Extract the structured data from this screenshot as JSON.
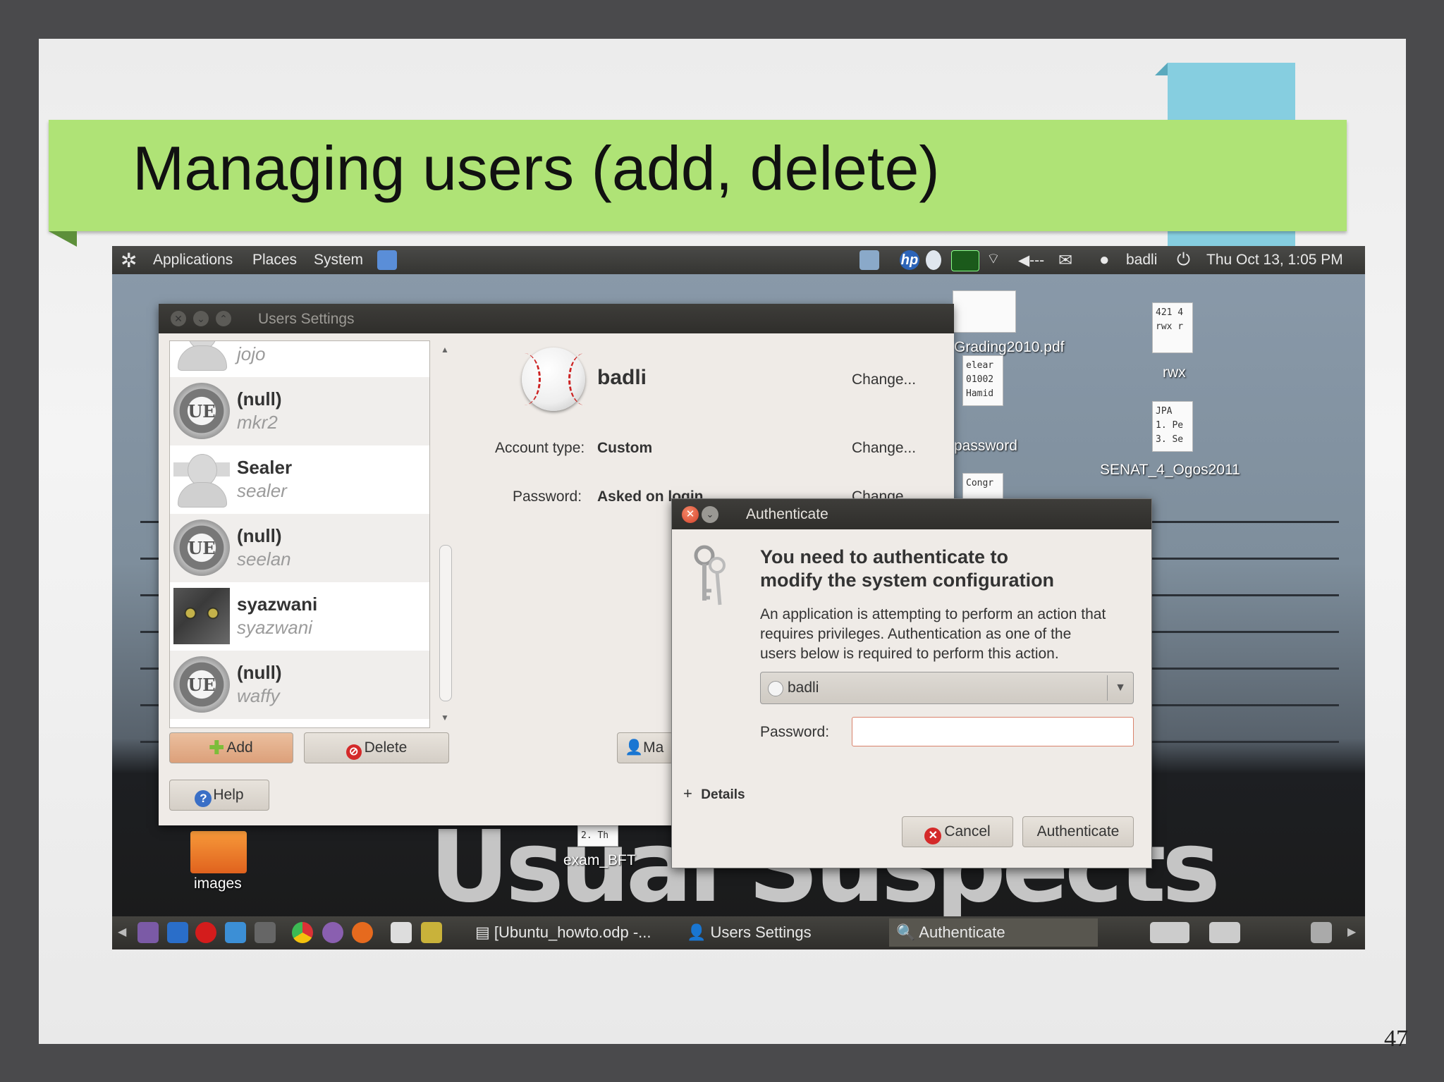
{
  "slide": {
    "title": "Managing users (add, delete)",
    "page_number": "47"
  },
  "top_panel": {
    "menus": [
      "Applications",
      "Places",
      "System"
    ],
    "user": "badli",
    "clock": "Thu Oct 13,  1:05 PM",
    "icons": [
      "ubuntu-logo-icon",
      "network-wizard-icon",
      "display-settings-icon",
      "hp-printer-icon",
      "clock-applet-icon",
      "system-monitor-icon",
      "wifi-icon",
      "volume-icon",
      "mail-icon",
      "user-icon",
      "power-icon"
    ]
  },
  "desktop": {
    "icons": [
      {
        "label": "Grading2010.pdf"
      },
      {
        "label": "rwx",
        "file_text": "421 4\nrwx r"
      },
      {
        "label": "password",
        "file_text": "elear\n01002\nHamid"
      },
      {
        "label": "SENAT_4_Ogos2011",
        "file_text": "JPA\n1. Pe\n3. Se"
      },
      {
        "label": "",
        "file_text": "Congr"
      },
      {
        "label": "exam_BFT",
        "file_text": "2. Th"
      },
      {
        "label": "images"
      }
    ],
    "wallpaper_text": "Usual Suspects"
  },
  "users_window": {
    "title": "Users Settings",
    "users": [
      {
        "name": "",
        "login": "jojo",
        "avatar": "person"
      },
      {
        "name": "(null)",
        "login": "mkr2",
        "avatar": "ue"
      },
      {
        "name": "Sealer",
        "login": "sealer",
        "avatar": "person"
      },
      {
        "name": "(null)",
        "login": "seelan",
        "avatar": "ue"
      },
      {
        "name": "syazwani",
        "login": "syazwani",
        "avatar": "cat"
      },
      {
        "name": "(null)",
        "login": "waffy",
        "avatar": "ue"
      }
    ],
    "avatar_ue_text": "UE",
    "selected_user": "badli",
    "account_type_label": "Account type:",
    "account_type_value": "Custom",
    "password_label": "Password:",
    "password_value": "Asked on login",
    "change_label": "Change...",
    "add_label": "Add",
    "delete_label": "Delete",
    "help_label": "Help",
    "manage_label": "Ma"
  },
  "auth_dialog": {
    "title": "Authenticate",
    "heading_line1": "You need to authenticate to",
    "heading_line2": "modify the system configuration",
    "body_line1": "An application is attempting to perform an action that",
    "body_line2": "requires privileges. Authentication as one of the",
    "body_line3": "users below is required to perform this action.",
    "selected_identity": "badli",
    "password_label": "Password:",
    "password_value": "",
    "details_label": "Details",
    "cancel_label": "Cancel",
    "authenticate_label": "Authenticate"
  },
  "bottom_panel": {
    "tasks": [
      {
        "label": "[Ubuntu_howto.odp -..."
      },
      {
        "label": "Users Settings"
      },
      {
        "label": "Authenticate",
        "active": true
      }
    ]
  }
}
